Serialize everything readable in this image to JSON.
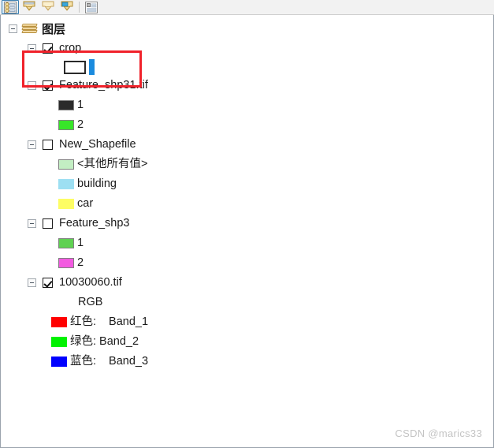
{
  "toolbar": {
    "buttons": [
      {
        "name": "list-by-drawing-order-icon",
        "title": "List By Drawing Order",
        "active": true
      },
      {
        "name": "list-by-source-icon",
        "title": "List By Source",
        "active": false
      },
      {
        "name": "list-by-visibility-icon",
        "title": "List By Visibility",
        "active": false
      },
      {
        "name": "list-by-selection-icon",
        "title": "List By Selection",
        "active": false
      },
      {
        "name": "options-icon",
        "title": "Options",
        "active": false
      }
    ]
  },
  "toc": {
    "root": {
      "label": "图层",
      "expander": "minus",
      "icon": "layers-stack-icon"
    },
    "layers": [
      {
        "id": "crop",
        "label": "crop",
        "checked": true,
        "highlighted": true,
        "symbols": [
          {
            "type": "hollow-rect",
            "label": "",
            "color": "#ffffff",
            "outline": "#2a2a2a"
          },
          {
            "type": "blue-bar",
            "label": "",
            "color": "#1b8bde"
          }
        ]
      },
      {
        "id": "feature_shp31",
        "label": "Feature_shp31.tif",
        "checked": true,
        "highlighted": false,
        "symbols": [
          {
            "type": "swatch",
            "label": "1",
            "color": "#2b2b2b",
            "bordered": true
          },
          {
            "type": "swatch",
            "label": "2",
            "color": "#38e529",
            "bordered": true
          }
        ]
      },
      {
        "id": "new_shapefile",
        "label": "New_Shapefile",
        "checked": false,
        "highlighted": false,
        "symbols": [
          {
            "type": "swatch",
            "label": "<其他所有值>",
            "color": "#c3eec3",
            "bordered": true
          },
          {
            "type": "swatch",
            "label": "building",
            "color": "#9ddff2",
            "bordered": false
          },
          {
            "type": "swatch",
            "label": "car",
            "color": "#fdfd64",
            "bordered": false
          }
        ]
      },
      {
        "id": "feature_shp3",
        "label": "Feature_shp3",
        "checked": false,
        "highlighted": false,
        "symbols": [
          {
            "type": "swatch",
            "label": "1",
            "color": "#5fd152",
            "bordered": true
          },
          {
            "type": "swatch",
            "label": "2",
            "color": "#f25ae0",
            "bordered": true
          }
        ]
      },
      {
        "id": "raster_10030060",
        "label": "10030060.tif",
        "checked": true,
        "highlighted": false,
        "group_label": "RGB",
        "symbols": [
          {
            "type": "swatch",
            "label": "红色:",
            "value": "Band_1",
            "color": "#ff0000",
            "bordered": false
          },
          {
            "type": "swatch",
            "label": "绿色:",
            "value": "Band_2",
            "color": "#00f200",
            "bordered": false
          },
          {
            "type": "swatch",
            "label": "蓝色:",
            "value": "Band_3",
            "color": "#0000ff",
            "bordered": false
          }
        ]
      }
    ]
  },
  "highlight": {
    "color": "#f0222b",
    "target": "crop"
  },
  "watermark": {
    "text": "CSDN @marics33"
  }
}
